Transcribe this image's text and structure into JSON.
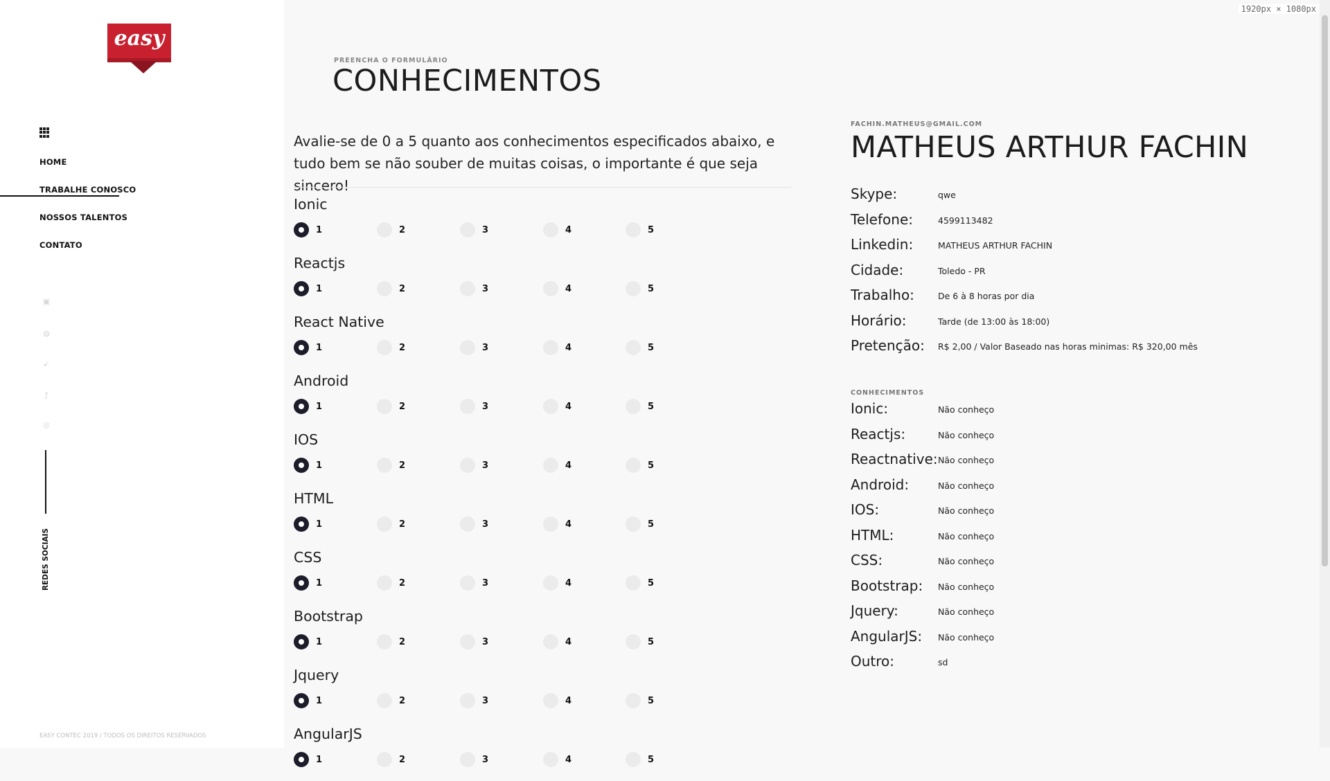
{
  "sidebar": {
    "logo_text": "easy",
    "nav": [
      "HOME",
      "TRABALHE CONOSCO",
      "NOSSOS TALENTOS",
      "CONTATO"
    ],
    "social_icons": [
      "instagram-icon",
      "dribbble-icon",
      "twitter-icon",
      "facebook-icon",
      "globe-icon"
    ],
    "social_label": "REDES SOCIAIS",
    "copyright": "EASY CONTEC 2019 / TODOS OS DIREITOS RESERVADOS"
  },
  "form": {
    "kicker": "PREENCHA O FORMULÁRIO",
    "title": "CONHECIMENTOS",
    "intro": "Avalie-se de 0 a 5 quanto aos conhecimentos especificados abaixo, e tudo bem se não souber de muitas coisas, o importante é que seja sincero!",
    "options": [
      "1",
      "2",
      "3",
      "4",
      "5"
    ],
    "skills": [
      {
        "name": "Ionic",
        "selected": "1"
      },
      {
        "name": "Reactjs",
        "selected": "1"
      },
      {
        "name": "React Native",
        "selected": "1"
      },
      {
        "name": "Android",
        "selected": "1"
      },
      {
        "name": "IOS",
        "selected": "1"
      },
      {
        "name": "HTML",
        "selected": "1"
      },
      {
        "name": "CSS",
        "selected": "1"
      },
      {
        "name": "Bootstrap",
        "selected": "1"
      },
      {
        "name": "Jquery",
        "selected": "1"
      },
      {
        "name": "AngularJS",
        "selected": "1"
      }
    ]
  },
  "summary": {
    "email": "FACHIN.MATHEUS@GMAIL.COM",
    "name": "MATHEUS ARTHUR FACHIN",
    "fields": [
      {
        "label": "Skype:",
        "value": "qwe"
      },
      {
        "label": "Telefone:",
        "value": "4599113482"
      },
      {
        "label": "Linkedin:",
        "value": "MATHEUS ARTHUR FACHIN"
      },
      {
        "label": "Cidade:",
        "value": "Toledo - PR"
      },
      {
        "label": "Trabalho:",
        "value": "De 6 à 8 horas por dia"
      },
      {
        "label": "Horário:",
        "value": "Tarde (de 13:00 às 18:00)"
      },
      {
        "label": "Pretenção:",
        "value": "R$ 2,00 / Valor Baseado nas horas minimas: R$ 320,00 mês"
      }
    ],
    "conhecimentos_label": "CONHECIMENTOS",
    "conhecimentos": [
      {
        "label": "Ionic:",
        "value": "Não conheço"
      },
      {
        "label": "Reactjs:",
        "value": "Não conheço"
      },
      {
        "label": "Reactnative:",
        "value": "Não conheço"
      },
      {
        "label": "Android:",
        "value": "Não conheço"
      },
      {
        "label": "IOS:",
        "value": "Não conheço"
      },
      {
        "label": "HTML:",
        "value": "Não conheço"
      },
      {
        "label": "CSS:",
        "value": "Não conheço"
      },
      {
        "label": "Bootstrap:",
        "value": "Não conheço"
      },
      {
        "label": "Jquery:",
        "value": "Não conheço"
      },
      {
        "label": "AngularJS:",
        "value": "Não conheço"
      },
      {
        "label": "Outro:",
        "value": "sd"
      }
    ]
  },
  "viewport_label": "1920px × 1080px"
}
